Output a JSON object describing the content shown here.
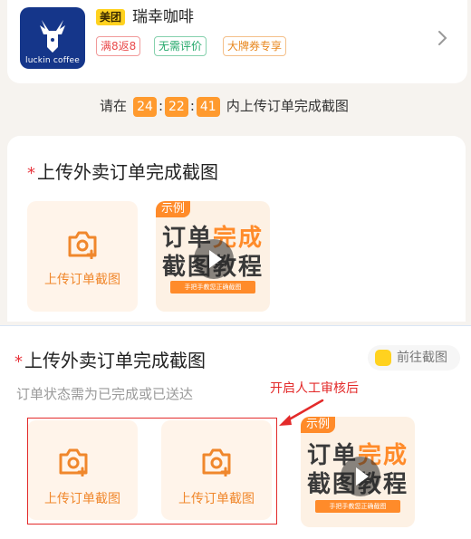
{
  "store": {
    "logo_text": "luckin coffee",
    "platform_badge": "美团",
    "name": "瑞幸咖啡",
    "tags": [
      "满8返8",
      "无需评价",
      "大牌券专享"
    ]
  },
  "countdown": {
    "prefix": "请在",
    "hours": "24",
    "minutes": "22",
    "seconds": "41",
    "suffix": "内上传订单完成截图"
  },
  "section1": {
    "star": "*",
    "title": "上传外卖订单完成截图",
    "upload_label": "上传订单截图",
    "example": {
      "badge": "示例",
      "line1_a": "订单",
      "line1_b": "完成",
      "line2_a": "截图",
      "line2_b": "教程",
      "strip": "手把手教您正确截图"
    }
  },
  "section2": {
    "star": "*",
    "title": "上传外卖订单完成截图",
    "goto_label": "前往截图",
    "hint": "订单状态需为已完成或已送达",
    "upload_label_1": "上传订单截图",
    "upload_label_2": "上传订单截图",
    "example": {
      "badge": "示例",
      "line1_a": "订单",
      "line1_b": "完成",
      "line2_a": "截图",
      "line2_b": "教程",
      "strip": "手把手教您正确截图"
    }
  },
  "annotation": {
    "text": "开启人工审核后",
    "color": "#e32a2a"
  },
  "colors": {
    "accent": "#ff8b2a",
    "brand_blue": "#15368a",
    "required_star": "#e8343c"
  },
  "icons": [
    "luckin-deer-logo",
    "chevron-right-icon",
    "camera-add-icon",
    "play-icon",
    "goto-screenshot-icon",
    "arrow-annotation"
  ]
}
